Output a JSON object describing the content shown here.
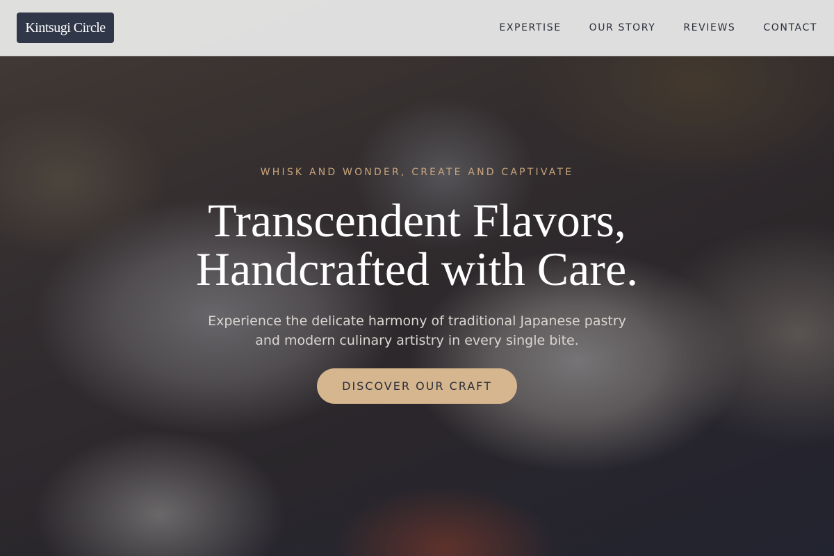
{
  "header": {
    "logo_text": "Kintsugi Circle",
    "nav": [
      {
        "label": "EXPERTISE"
      },
      {
        "label": "OUR STORY"
      },
      {
        "label": "REVIEWS"
      },
      {
        "label": "CONTACT"
      }
    ]
  },
  "hero": {
    "tagline": "WHISK AND WONDER, CREATE AND CAPTIVATE",
    "headline_line1": "Transcendent Flavors,",
    "headline_line2": "Handcrafted with Care.",
    "subtext_line1": "Experience the delicate harmony of traditional Japanese pastry",
    "subtext_line2": "and modern culinary artistry in every single bite.",
    "cta_label": "DISCOVER OUR CRAFT",
    "background_image": "japanese-meal-photo"
  },
  "colors": {
    "logo_bg": "#2f3748",
    "header_bg": "#ececec",
    "accent": "#d6b68f",
    "tagline": "#c9a57c",
    "nav_text": "#2b2f3a"
  }
}
